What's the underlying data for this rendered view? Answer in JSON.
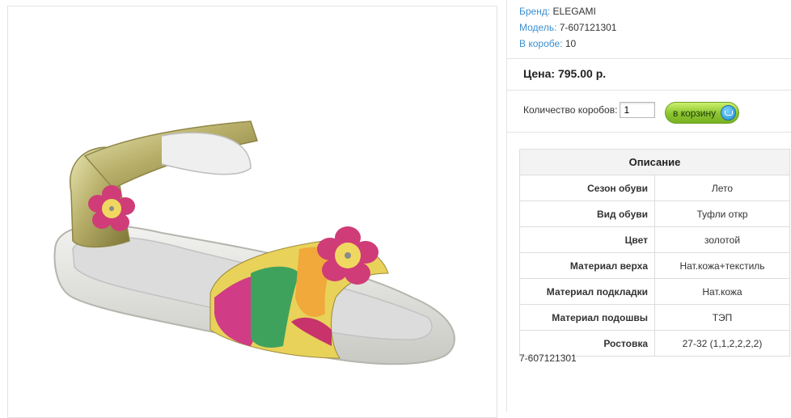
{
  "product_image": {
    "alt": "sandal"
  },
  "info": {
    "brand_label": "Бренд:",
    "brand_value": "ELEGAMI",
    "model_label": "Модель:",
    "model_value": "7-607121301",
    "box_label": "В коробе:",
    "box_value": "10"
  },
  "price": "Цена: 795.00 р.",
  "quantity": {
    "label": "Количество коробов:",
    "value": "1"
  },
  "cart_button": {
    "label": "в корзину",
    "icon": "cart-icon"
  },
  "description": {
    "title": "Описание",
    "rows": [
      {
        "key": "Сезон обуви",
        "value": "Лето"
      },
      {
        "key": "Вид обуви",
        "value": "Туфли откр"
      },
      {
        "key": "Цвет",
        "value": "золотой"
      },
      {
        "key": "Материал верха",
        "value": "Нат.кожа+текстиль"
      },
      {
        "key": "Материал подкладки",
        "value": "Нат.кожа"
      },
      {
        "key": "Материал подошвы",
        "value": "ТЭП"
      },
      {
        "key": "Ростовка",
        "value": "27-32 (1,1,2,2,2,2)"
      }
    ]
  },
  "sku": "7-607121301",
  "colors": {
    "link": "#3b8fcf",
    "button_green": "#8cc431",
    "border": "#dddddd"
  }
}
